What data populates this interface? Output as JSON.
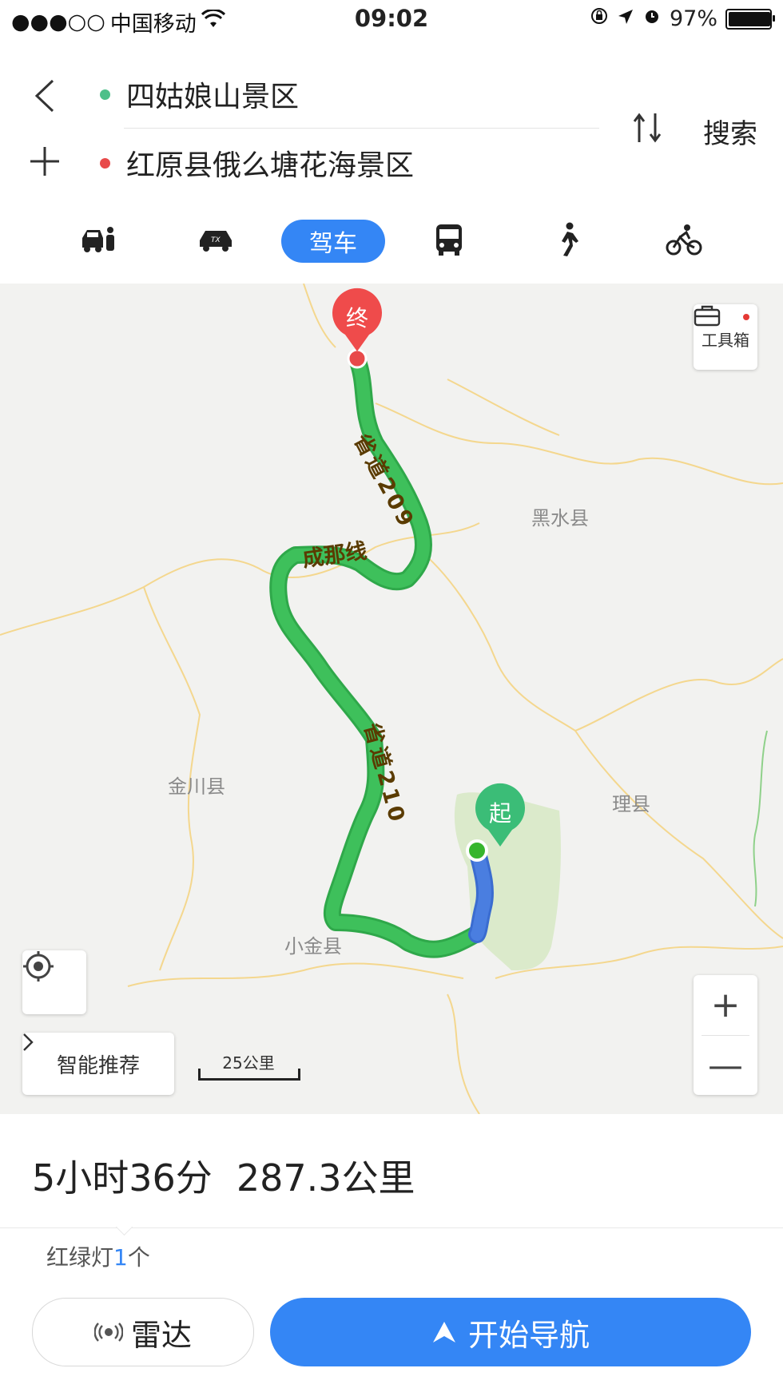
{
  "status_bar": {
    "signal": "●●●○○",
    "carrier": "中国移动",
    "time": "09:02",
    "battery": "97%",
    "battery_level": 0.97
  },
  "header": {
    "start": "四姑娘山景区",
    "end": "红原县俄么塘花海景区",
    "search_label": "搜索",
    "start_color": "#4cc089",
    "end_color": "#e84a4a"
  },
  "modes": {
    "active_label": "驾车",
    "items": [
      "car-share-icon",
      "taxi-icon",
      "car-icon",
      "bus-icon",
      "walk-icon",
      "bike-icon"
    ]
  },
  "map": {
    "end_marker": "终",
    "start_marker": "起",
    "roads": [
      {
        "label": "省道209"
      },
      {
        "label": "成那线"
      },
      {
        "label": "省道210"
      }
    ],
    "towns": [
      "黑水县",
      "金川县",
      "理县",
      "小金县"
    ],
    "toolbox_label": "工具箱",
    "recommend_label": "智能推荐",
    "scale_label": "25公里",
    "zoom_in": "+",
    "zoom_out": "—",
    "route_color": "#3ec05b",
    "start_segment_color": "#4a7ee0"
  },
  "summary": {
    "duration": "5小时36分",
    "distance": "287.3公里"
  },
  "traffic_lights": {
    "prefix": "红绿灯",
    "count": "1",
    "suffix": "个"
  },
  "actions": {
    "radar_label": "雷达",
    "navigate_label": "开始导航",
    "accent": "#3486f5"
  }
}
